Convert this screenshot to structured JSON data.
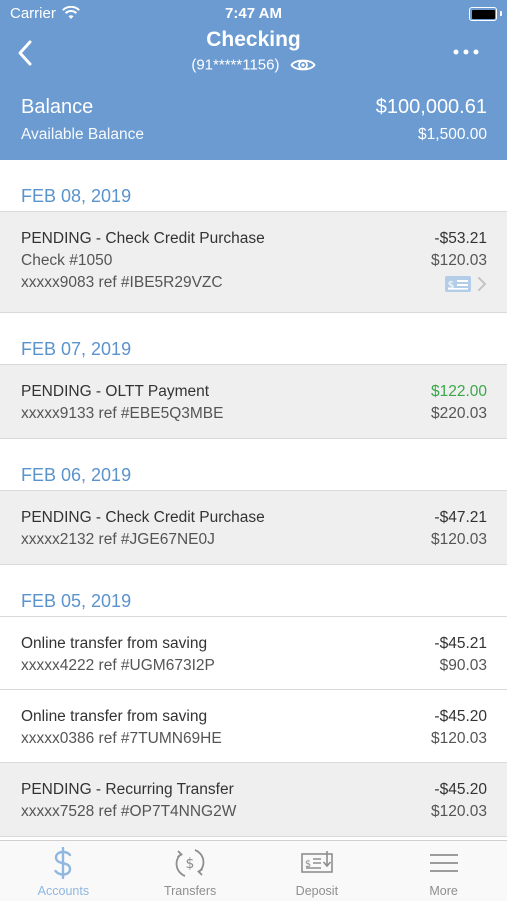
{
  "status_bar": {
    "carrier": "Carrier",
    "time": "7:47 AM"
  },
  "header": {
    "title": "Checking",
    "account_mask": "(91*****1156)",
    "balance_label": "Balance",
    "balance_value": "$100,000.61",
    "available_label": "Available Balance",
    "available_value": "$1,500.00"
  },
  "groups": [
    {
      "date": "FEB 08, 2019",
      "transactions": [
        {
          "description": "PENDING - Check Credit Purchase",
          "line2": "Check #1050",
          "line3": "xxxxx9083 ref #IBE5R29VZC",
          "amount": "-$53.21",
          "balance": "$120.03",
          "status": "pending"
        }
      ]
    },
    {
      "date": "FEB 07, 2019",
      "transactions": [
        {
          "description": "PENDING - OLTT Payment",
          "line2": "xxxxx9133 ref #EBE5Q3MBE",
          "amount": "$122.00",
          "balance": "$220.03",
          "status": "pending"
        }
      ]
    },
    {
      "date": "FEB 06, 2019",
      "transactions": [
        {
          "description": "PENDING - Check Credit Purchase",
          "line2": "xxxxx2132 ref #JGE67NE0J",
          "amount": "-$47.21",
          "balance": "$120.03",
          "status": "pending"
        }
      ]
    },
    {
      "date": "FEB 05, 2019",
      "transactions": [
        {
          "description": "Online transfer from saving",
          "line2": "xxxxx4222 ref #UGM673I2P",
          "amount": "-$45.21",
          "balance": "$90.03",
          "status": "posted"
        },
        {
          "description": "Online transfer from saving",
          "line2": "xxxxx0386 ref #7TUMN69HE",
          "amount": "-$45.20",
          "balance": "$120.03",
          "status": "posted"
        },
        {
          "description": "PENDING - Recurring Transfer",
          "line2": "xxxxx7528 ref #OP7T4NNG2W",
          "amount": "-$45.20",
          "balance": "$120.03",
          "status": "pending"
        }
      ]
    }
  ],
  "tabs": [
    {
      "label": "Accounts",
      "icon": "dollar-icon",
      "active": true
    },
    {
      "label": "Transfers",
      "icon": "transfer-cycle-icon",
      "active": false
    },
    {
      "label": "Deposit",
      "icon": "check-deposit-icon",
      "active": false
    },
    {
      "label": "More",
      "icon": "menu-icon",
      "active": false
    }
  ],
  "colors": {
    "header_bg": "#6b9bd1",
    "date_text": "#5b93cd",
    "positive_amount": "#3aa84a",
    "active_tab": "#8fb7e0"
  }
}
